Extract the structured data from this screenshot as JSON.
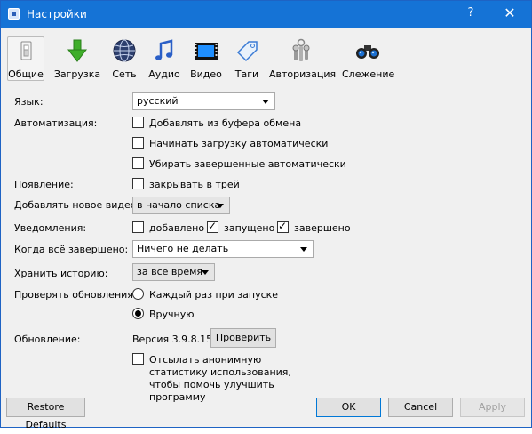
{
  "window": {
    "title": "Настройки",
    "help_label": "?",
    "close_label": "✕"
  },
  "toolbar": [
    {
      "label": "Общие",
      "icon": "switch-icon"
    },
    {
      "label": "Загрузка",
      "icon": "download-arrow-icon"
    },
    {
      "label": "Сеть",
      "icon": "globe-icon"
    },
    {
      "label": "Аудио",
      "icon": "music-note-icon"
    },
    {
      "label": "Видео",
      "icon": "film-icon"
    },
    {
      "label": "Таги",
      "icon": "tag-icon"
    },
    {
      "label": "Авторизация",
      "icon": "keys-icon"
    },
    {
      "label": "Слежение",
      "icon": "binoculars-icon"
    }
  ],
  "language": {
    "label": "Язык:",
    "value": "русский"
  },
  "automation": {
    "label": "Автоматизация:",
    "clipboard": {
      "text": "Добавлять из буфера обмена",
      "checked": false
    },
    "autostart": {
      "text": "Начинать загрузку автоматически",
      "checked": false
    },
    "autoremove": {
      "text": "Убирать завершенные автоматически",
      "checked": false
    }
  },
  "appearance": {
    "label": "Появление:",
    "tray": {
      "text": "закрывать в трей",
      "checked": false
    }
  },
  "add_video": {
    "label": "Добавлять новое видео:",
    "value": "в начало списка"
  },
  "notifications": {
    "label": "Уведомления:",
    "added": {
      "text": "добавлено",
      "checked": false
    },
    "started": {
      "text": "запущено",
      "checked": true
    },
    "finished": {
      "text": "завершено",
      "checked": true
    }
  },
  "when_done": {
    "label": "Когда всё завершено:",
    "value": "Ничего не делать"
  },
  "history": {
    "label": "Хранить историю:",
    "value": "за все время"
  },
  "updates": {
    "label": "Проверять обновления:",
    "each_start": {
      "text": "Каждый раз при запуске",
      "selected": false
    },
    "manual": {
      "text": "Вручную",
      "selected": true
    }
  },
  "update": {
    "label": "Обновление:",
    "version": "Версия 3.9.8.15",
    "check_button": "Проверить"
  },
  "statistics": {
    "text": "Отсылать анонимную статистику использования, чтобы помочь улучшить программу",
    "checked": false
  },
  "footer": {
    "restore": "Restore Defaults",
    "ok": "OK",
    "cancel": "Cancel",
    "apply": "Apply"
  },
  "colors": {
    "titlebar": "#1573d6",
    "accent": "#0078d7"
  }
}
